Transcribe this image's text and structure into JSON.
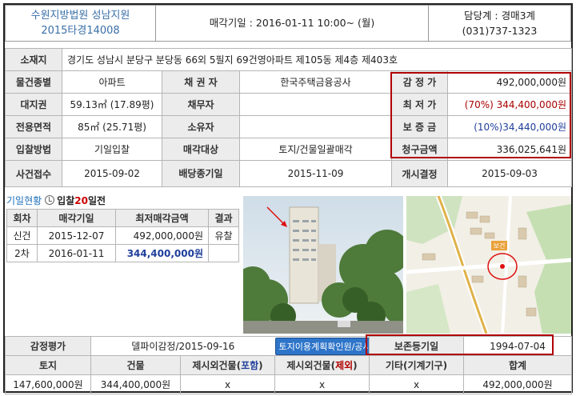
{
  "header": {
    "court": "수원지방법원 성남지원",
    "case_no": "2015타경14008",
    "sale_date": "매각기일 : 2016-01-11   10:00~ (월)",
    "manager": "담당계 : 경매3계",
    "phone": "(031)737-1323"
  },
  "info": {
    "address_label": "소재지",
    "address": "경기도 성남시 분당구 분당동 66외 5필지 69건영아파트 제105동 제4층 제403호",
    "type_label": "물건종별",
    "type": "아파트",
    "creditor_label": "채 권 자",
    "creditor": "한국주택금융공사",
    "appraisal_label": "감 정 가",
    "appraisal": "492,000,000원",
    "land_label": "대지권",
    "land": "59.13㎡ (17.89평)",
    "debtor_label": "채무자",
    "debtor": "",
    "min_price_label": "최 저 가",
    "min_price": "(70%) 344,400,000원",
    "area_label": "전용면적",
    "area": "85㎡ (25.71평)",
    "owner_label": "소유자",
    "owner": "",
    "deposit_label": "보 증 금",
    "deposit": "(10%)34,440,000원",
    "bid_method_label": "입찰방법",
    "bid_method": "기일입찰",
    "sale_target_label": "매각대상",
    "sale_target": "토지/건물일괄매각",
    "claim_label": "청구금액",
    "claim": "336,025,641원",
    "case_received_label": "사건접수",
    "case_received": "2015-09-02",
    "dividend_deadline_label": "배당종기일",
    "dividend_deadline": "2015-11-09",
    "start_decision_label": "개시결정",
    "start_decision": "2015-09-03"
  },
  "history": {
    "title": "기일현황",
    "countdown_prefix": "입찰",
    "countdown_num": "20",
    "countdown_suffix": "일전",
    "columns": [
      "회차",
      "매각기일",
      "최저매각금액",
      "결과"
    ],
    "rows": [
      {
        "round": "신건",
        "date": "2015-12-07",
        "price": "492,000,000원",
        "result": "유찰"
      },
      {
        "round": "2차",
        "date": "2016-01-11",
        "price": "344,400,000원",
        "result": ""
      }
    ]
  },
  "bottom": {
    "appraisal_eval_label": "감정평가",
    "appraiser": "델파이감정/2015-09-16",
    "land_use_button": "토지이용계획확인원/공시지가",
    "registry_label": "보존등기일",
    "registry_date": "1994-07-04",
    "columns": {
      "land": "토지",
      "building": "건물",
      "excl_incl_prefix": "제시외건물(",
      "excl_incl_word": "포함",
      "excl_excl_prefix": "제시외건물(",
      "excl_excl_word": "제외",
      "close_paren": ")",
      "other": "기타(기계기구)",
      "total": "합계"
    },
    "values": {
      "land": "147,600,000원",
      "building": "344,400,000원",
      "excl_incl": "x",
      "excl_excl": "x",
      "other": "x",
      "total": "492,000,000원"
    }
  },
  "map": {
    "badge": "보건"
  },
  "colors": {
    "court_blue": "#3a6fa8",
    "alert_red": "#b00000",
    "button_blue": "#2e75c9"
  }
}
